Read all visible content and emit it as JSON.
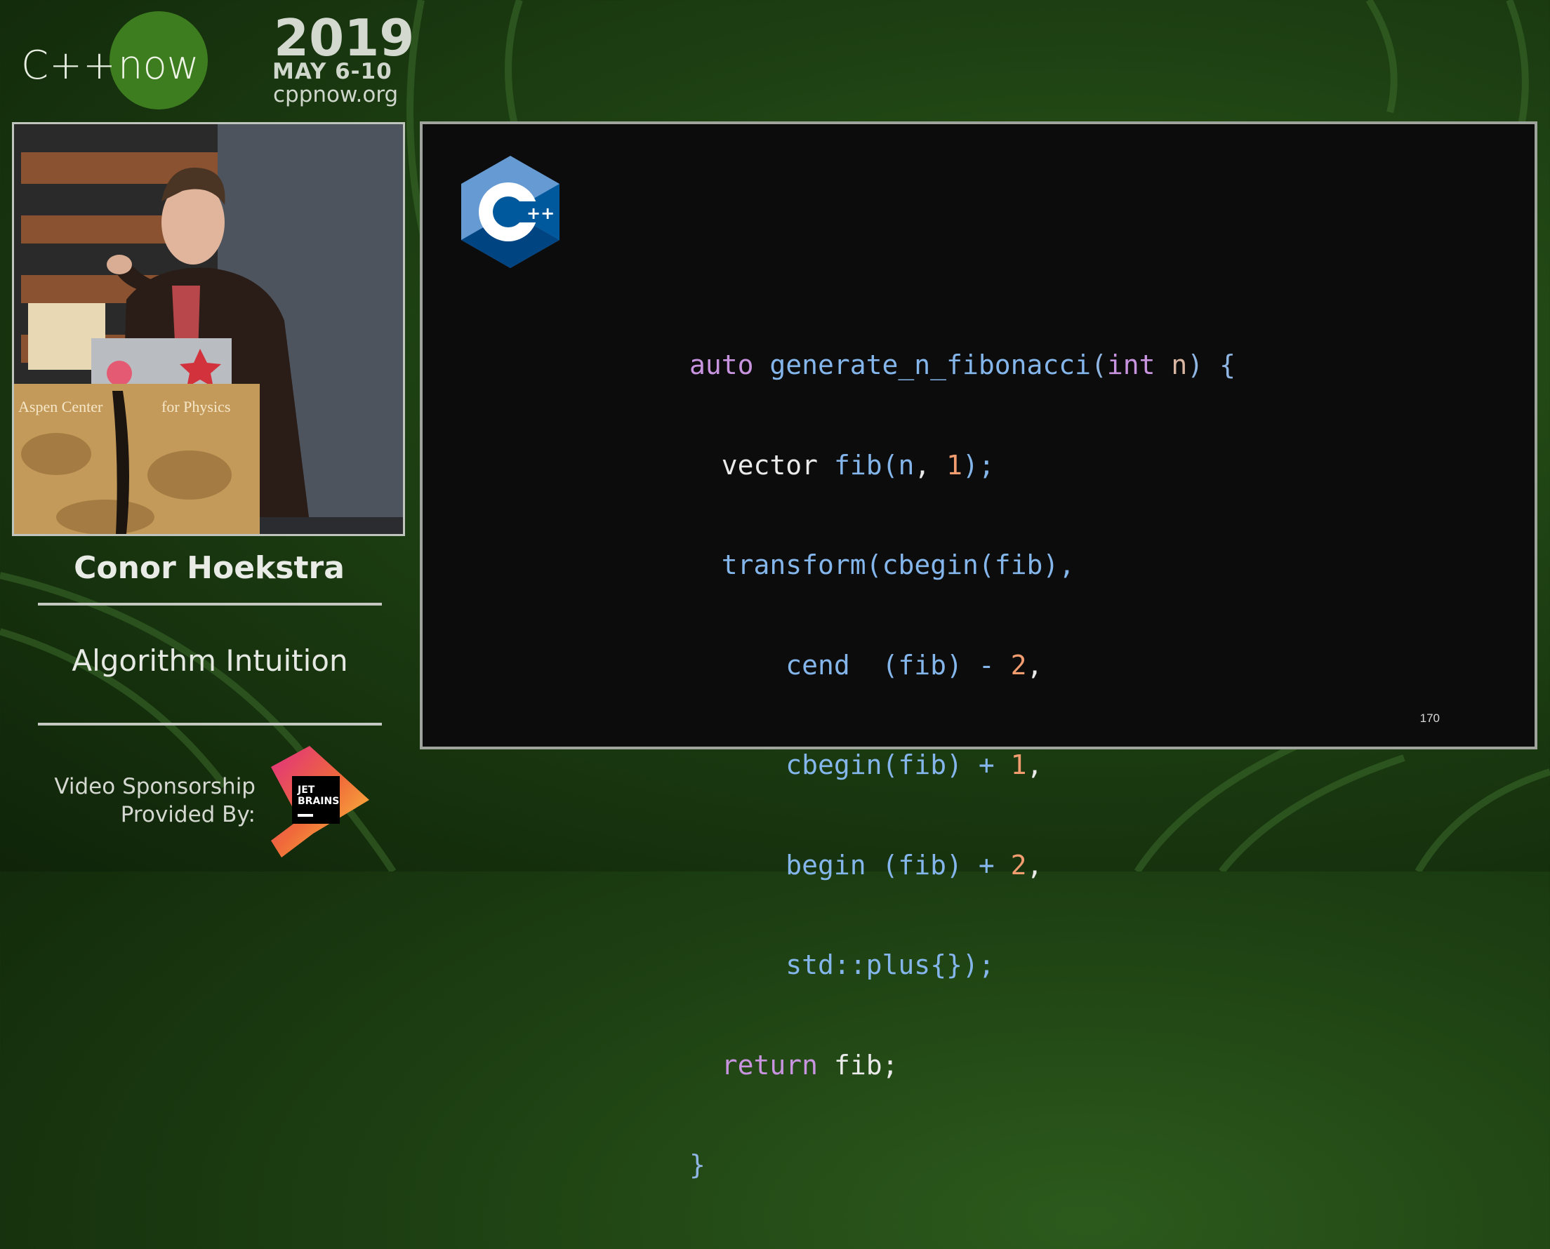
{
  "branding": {
    "cpp": "C++",
    "now": "now",
    "year": "2019",
    "dates": "MAY 6-10",
    "url": "cppnow.org"
  },
  "speaker": {
    "name": "Conor Hoekstra",
    "talk_title": "Algorithm Intuition",
    "podium_text_left": "Aspen Center",
    "podium_text_right": "for Physics"
  },
  "sponsor": {
    "line1": "Video Sponsorship",
    "line2": "Provided By:",
    "logo_text_1": "JET",
    "logo_text_2": "BRAINS"
  },
  "slide": {
    "logo_text": "++",
    "page_number": "170",
    "code": {
      "l1": {
        "kw": "auto",
        "fn": "generate_n_fibonacci",
        "open": "(",
        "type": "int",
        "param": "n",
        "close": ")",
        "brace": "{"
      },
      "l2": {
        "ident": "vector",
        "fn": "fib",
        "open": "(",
        "arg": "n",
        "comma": ", ",
        "num": "1",
        "end": ");"
      },
      "l3": {
        "fn": "transform",
        "inner": "cbegin",
        "arg": "(fib),"
      },
      "l4": {
        "fn": "cend",
        "arg": "  (fib) - ",
        "num": "2",
        "end": ","
      },
      "l5": {
        "fn": "cbegin",
        "arg": "(fib) + ",
        "num": "1",
        "end": ","
      },
      "l6": {
        "fn": "begin",
        "arg": " (fib) + ",
        "num": "2",
        "end": ","
      },
      "l7": {
        "fn": "std::plus",
        "end": "{});"
      },
      "l8": {
        "kw": "return",
        "ident": "fib;"
      },
      "l9": {
        "brace": "}"
      }
    }
  },
  "colors": {
    "background": "#1d3f12",
    "slide_bg": "#0c0c0c",
    "keyword": "#c894e0",
    "function": "#84b6eb",
    "number": "#f29d70"
  }
}
